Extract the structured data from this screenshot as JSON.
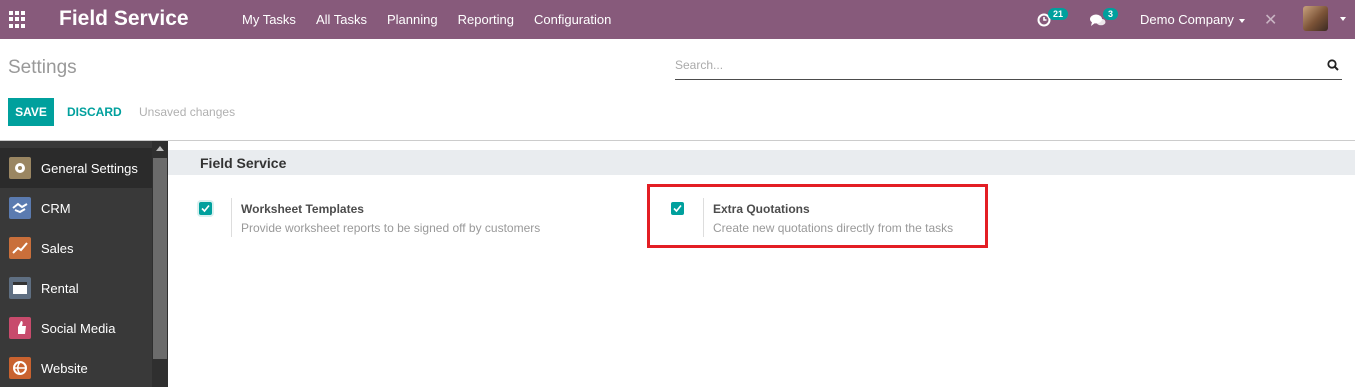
{
  "navbar": {
    "app_name": "Field Service",
    "menu": [
      "My Tasks",
      "All Tasks",
      "Planning",
      "Reporting",
      "Configuration"
    ],
    "activity_count": "21",
    "message_count": "3",
    "company": "Demo Company",
    "accent_color": "#875a7b"
  },
  "control_panel": {
    "title": "Settings",
    "search_placeholder": "Search...",
    "save_label": "SAVE",
    "discard_label": "DISCARD",
    "status": "Unsaved changes"
  },
  "sidebar": {
    "items": [
      {
        "label": "General Settings",
        "icon": "gear-icon",
        "color": "#9a8662"
      },
      {
        "label": "CRM",
        "icon": "handshake-icon",
        "color": "#5b7bb0"
      },
      {
        "label": "Sales",
        "icon": "chart-line-icon",
        "color": "#c96f3b"
      },
      {
        "label": "Rental",
        "icon": "calendar-icon",
        "color": "#5f6f82"
      },
      {
        "label": "Social Media",
        "icon": "thumbs-up-icon",
        "color": "#c84b6c"
      },
      {
        "label": "Website",
        "icon": "globe-icon",
        "color": "#c9622f"
      }
    ]
  },
  "section": {
    "title": "Field Service",
    "options": [
      {
        "title": "Worksheet Templates",
        "description": "Provide worksheet reports to be signed off by customers",
        "checked": true
      },
      {
        "title": "Extra Quotations",
        "description": "Create new quotations directly from the tasks",
        "checked": true
      }
    ]
  },
  "colors": {
    "primary": "#00a09d",
    "highlight_box": "#e31e24"
  }
}
